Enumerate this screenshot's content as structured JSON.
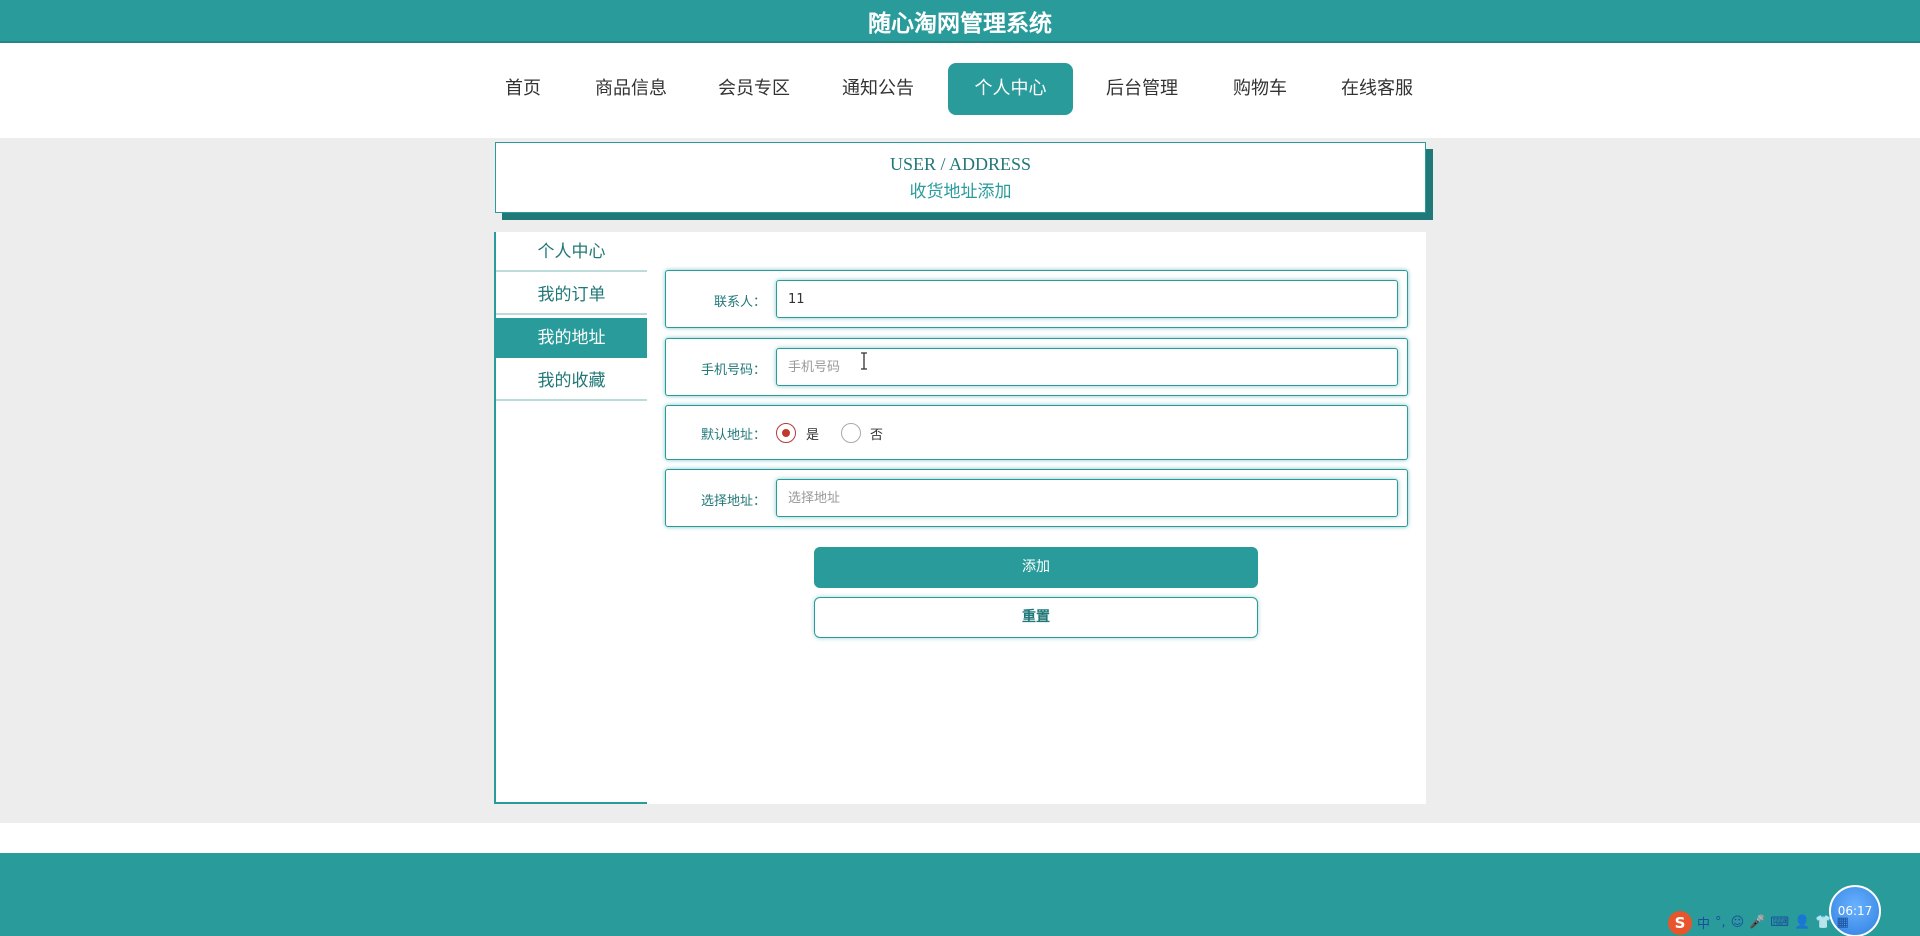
{
  "app": {
    "title": "随心淘网管理系统"
  },
  "nav": {
    "items": [
      {
        "label": "首页"
      },
      {
        "label": "商品信息"
      },
      {
        "label": "会员专区"
      },
      {
        "label": "通知公告"
      },
      {
        "label": "个人中心",
        "active": true
      },
      {
        "label": "后台管理"
      },
      {
        "label": "购物车"
      },
      {
        "label": "在线客服"
      }
    ]
  },
  "page_header": {
    "en": "USER / ADDRESS",
    "cn": "收货地址添加"
  },
  "sidebar": {
    "items": [
      {
        "label": "个人中心"
      },
      {
        "label": "我的订单"
      },
      {
        "label": "我的地址",
        "active": true
      },
      {
        "label": "我的收藏"
      }
    ]
  },
  "form": {
    "contact": {
      "label": "联系人：",
      "value": "11"
    },
    "phone": {
      "label": "手机号码：",
      "placeholder": "手机号码",
      "value": ""
    },
    "default_address": {
      "label": "默认地址：",
      "options": [
        "是",
        "否"
      ],
      "selected": "是"
    },
    "address": {
      "label": "选择地址：",
      "placeholder": "选择地址",
      "value": ""
    }
  },
  "actions": {
    "add_label": "添加",
    "reset_label": "重置"
  },
  "taskbar": {
    "ime_logo": "S",
    "ime_mode": "中",
    "ime_glyphs": [
      "°,",
      "☺",
      "🎤",
      "⌨",
      "👤",
      "👕",
      "▦"
    ],
    "clock": "06:17"
  },
  "colors": {
    "primary": "#2a9b9b",
    "primary_dark": "#217878",
    "page_bg": "#ededed",
    "radio_checked": "#c0392b"
  }
}
